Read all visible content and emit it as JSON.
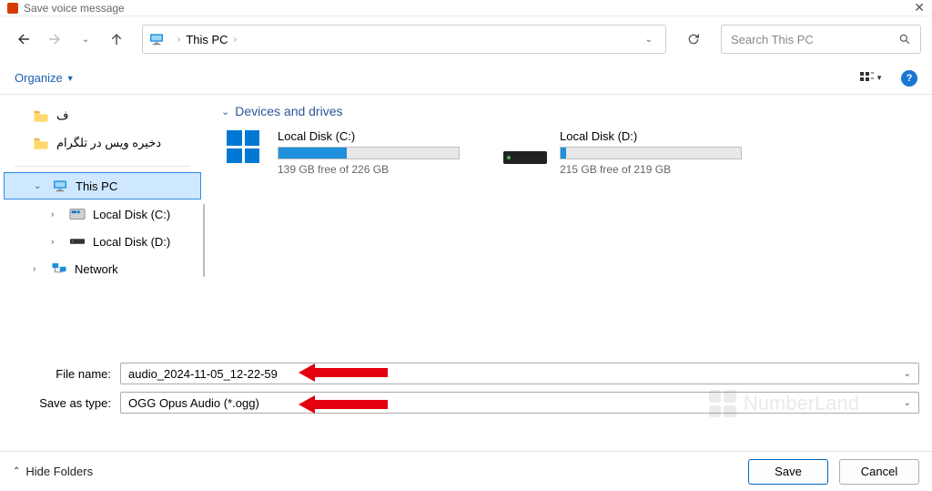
{
  "title": "Save voice message",
  "nav": {
    "breadcrumb": "This PC"
  },
  "search": {
    "placeholder": "Search This PC"
  },
  "toolbar": {
    "organize": "Organize"
  },
  "sidebar": {
    "folders": [
      {
        "name": "ف"
      },
      {
        "name": "دخیره ویس در تلگرام"
      }
    ],
    "this_pc": "This PC",
    "local_c": "Local Disk (C:)",
    "local_d": "Local Disk (D:)",
    "network": "Network"
  },
  "content": {
    "section": "Devices and drives",
    "drives": [
      {
        "name": "Local Disk (C:)",
        "free": "139 GB free of 226 GB",
        "fill_pct": 38
      },
      {
        "name": "Local Disk (D:)",
        "free": "215 GB free of 219 GB",
        "fill_pct": 3
      }
    ]
  },
  "fields": {
    "filename_label": "File name:",
    "filename_value": "audio_2024-11-05_12-22-59",
    "savetype_label": "Save as type:",
    "savetype_value": "OGG Opus Audio (*.ogg)"
  },
  "footer": {
    "hide": "Hide Folders",
    "save": "Save",
    "cancel": "Cancel"
  },
  "watermark": "NumberLand"
}
